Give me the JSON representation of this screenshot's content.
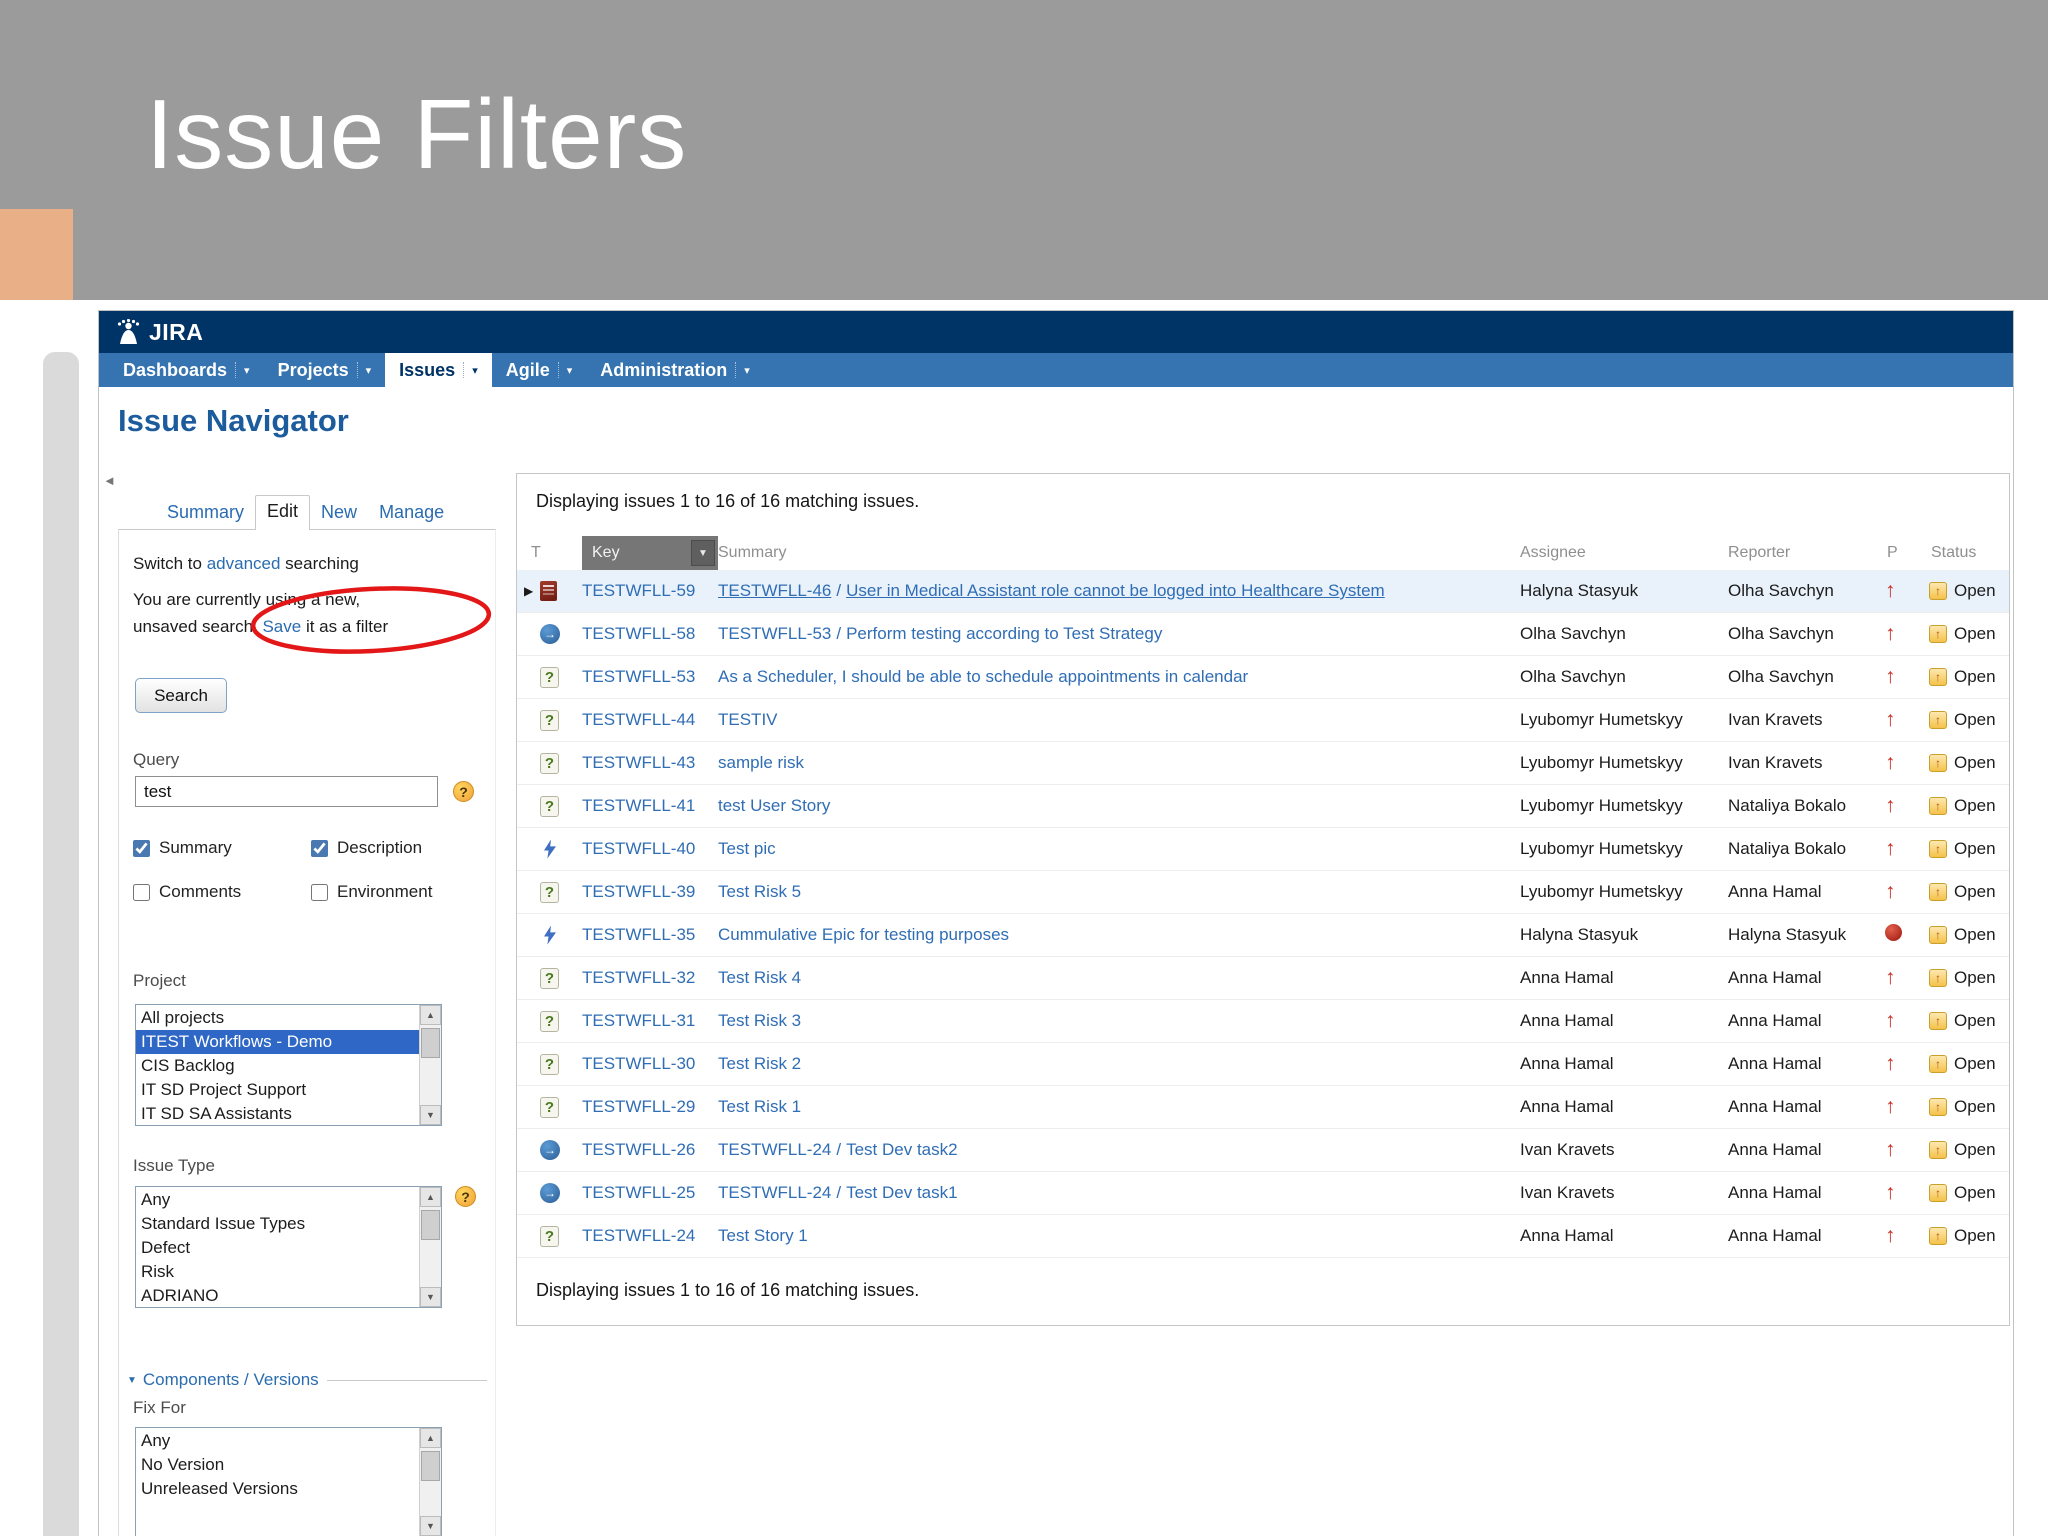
{
  "slide": {
    "title": "Issue Filters"
  },
  "colors": {
    "header_bg": "#003366",
    "nav_bg": "#3573b1",
    "link": "#2f6db5",
    "annotation": "#e31717",
    "highlight_row": "#e9f2fb",
    "selected_option_bg": "#2e67c6",
    "accent_square": "#e9b088",
    "band": "#9b9b9b"
  },
  "icons": {
    "current_marker": "▶",
    "type_question": "?",
    "subtask_arrow": "→",
    "priority_arrow": "↑",
    "status_arrow": "↑",
    "scroll_up": "▲",
    "scroll_down": "▼",
    "sort": "▼",
    "nav_caret": "▾",
    "collapse": "◄",
    "help": "?",
    "section_triangle": "▼"
  },
  "app": {
    "logo_text": "JIRA",
    "nav": [
      {
        "label": "Dashboards"
      },
      {
        "label": "Projects"
      },
      {
        "label": "Issues",
        "active": true
      },
      {
        "label": "Agile"
      },
      {
        "label": "Administration"
      }
    ],
    "page_title": "Issue Navigator"
  },
  "sidebar": {
    "tabs": [
      {
        "label": "Summary"
      },
      {
        "label": "Edit",
        "active": true
      },
      {
        "label": "New"
      },
      {
        "label": "Manage"
      }
    ],
    "switch_prefix": "Switch to ",
    "switch_link": "advanced",
    "switch_suffix": " searching",
    "unsaved_line1": "You are currently using a new,",
    "unsaved_line2_pre": "unsaved search. ",
    "unsaved_link": "Save",
    "unsaved_line2_post": " it as a filter",
    "search_button": "Search",
    "query": {
      "label": "Query",
      "value": "test"
    },
    "checkboxes": [
      {
        "label": "Summary",
        "checked": true
      },
      {
        "label": "Description",
        "checked": true
      },
      {
        "label": "Comments",
        "checked": false
      },
      {
        "label": "Environment",
        "checked": false
      }
    ],
    "project": {
      "label": "Project",
      "options": [
        "All projects",
        "ITEST Workflows - Demo",
        "CIS Backlog",
        "IT SD Project Support",
        "IT SD SA Assistants"
      ],
      "selected": "ITEST Workflows - Demo"
    },
    "issue_type": {
      "label": "Issue Type",
      "options": [
        "Any",
        "Standard Issue Types",
        "Defect",
        "Risk",
        "ADRIANO"
      ],
      "selected": ""
    },
    "components_versions": {
      "header": "Components / Versions"
    },
    "fix_for": {
      "label": "Fix For",
      "options": [
        "Any",
        "No Version",
        "Unreleased Versions"
      ],
      "selected": ""
    }
  },
  "results": {
    "count_top": "Displaying issues 1 to 16 of 16 matching issues.",
    "count_bottom": "Displaying issues 1 to 16 of 16 matching issues.",
    "columns": {
      "t": "T",
      "key": "Key",
      "summary": "Summary",
      "assignee": "Assignee",
      "reporter": "Reporter",
      "priority": "P",
      "status": "Status"
    },
    "rows": [
      {
        "key": "TESTWFLL-59",
        "parent": "TESTWFLL-46",
        "summary": "User in Medical Assistant role cannot be logged into Healthcare System",
        "assignee": "Halyna Stasyuk",
        "reporter": "Olha Savchyn",
        "type": "doc",
        "priority": "major",
        "status": "Open",
        "current": true
      },
      {
        "key": "TESTWFLL-58",
        "parent": "TESTWFLL-53",
        "summary": "Perform testing according to Test Strategy",
        "assignee": "Olha Savchyn",
        "reporter": "Olha Savchyn",
        "type": "subtask",
        "priority": "major",
        "status": "Open"
      },
      {
        "key": "TESTWFLL-53",
        "parent": "",
        "summary": "As a Scheduler, I should be able to schedule appointments in calendar",
        "assignee": "Olha Savchyn",
        "reporter": "Olha Savchyn",
        "type": "question",
        "priority": "major",
        "status": "Open"
      },
      {
        "key": "TESTWFLL-44",
        "parent": "",
        "summary": "TESTIV",
        "assignee": "Lyubomyr Humetskyy",
        "reporter": "Ivan Kravets",
        "type": "question",
        "priority": "major",
        "status": "Open"
      },
      {
        "key": "TESTWFLL-43",
        "parent": "",
        "summary": "sample risk",
        "assignee": "Lyubomyr Humetskyy",
        "reporter": "Ivan Kravets",
        "type": "question",
        "priority": "major",
        "status": "Open"
      },
      {
        "key": "TESTWFLL-41",
        "parent": "",
        "summary": "test User Story",
        "assignee": "Lyubomyr Humetskyy",
        "reporter": "Nataliya Bokalo",
        "type": "question",
        "priority": "major",
        "status": "Open"
      },
      {
        "key": "TESTWFLL-40",
        "parent": "",
        "summary": "Test pic",
        "assignee": "Lyubomyr Humetskyy",
        "reporter": "Nataliya Bokalo",
        "type": "epic",
        "priority": "major",
        "status": "Open"
      },
      {
        "key": "TESTWFLL-39",
        "parent": "",
        "summary": "Test Risk 5",
        "assignee": "Lyubomyr Humetskyy",
        "reporter": "Anna Hamal",
        "type": "question",
        "priority": "major",
        "status": "Open"
      },
      {
        "key": "TESTWFLL-35",
        "parent": "",
        "summary": "Cummulative Epic for testing purposes",
        "assignee": "Halyna Stasyuk",
        "reporter": "Halyna Stasyuk",
        "type": "epic",
        "priority": "blocker",
        "status": "Open"
      },
      {
        "key": "TESTWFLL-32",
        "parent": "",
        "summary": "Test Risk 4",
        "assignee": "Anna Hamal",
        "reporter": "Anna Hamal",
        "type": "question",
        "priority": "major",
        "status": "Open"
      },
      {
        "key": "TESTWFLL-31",
        "parent": "",
        "summary": "Test Risk 3",
        "assignee": "Anna Hamal",
        "reporter": "Anna Hamal",
        "type": "question",
        "priority": "major",
        "status": "Open"
      },
      {
        "key": "TESTWFLL-30",
        "parent": "",
        "summary": "Test Risk 2",
        "assignee": "Anna Hamal",
        "reporter": "Anna Hamal",
        "type": "question",
        "priority": "major",
        "status": "Open"
      },
      {
        "key": "TESTWFLL-29",
        "parent": "",
        "summary": "Test Risk 1",
        "assignee": "Anna Hamal",
        "reporter": "Anna Hamal",
        "type": "question",
        "priority": "major",
        "status": "Open"
      },
      {
        "key": "TESTWFLL-26",
        "parent": "TESTWFLL-24",
        "summary": "Test Dev task2",
        "assignee": "Ivan Kravets",
        "reporter": "Anna Hamal",
        "type": "subtask",
        "priority": "major",
        "status": "Open"
      },
      {
        "key": "TESTWFLL-25",
        "parent": "TESTWFLL-24",
        "summary": "Test Dev task1",
        "assignee": "Ivan Kravets",
        "reporter": "Anna Hamal",
        "type": "subtask",
        "priority": "major",
        "status": "Open"
      },
      {
        "key": "TESTWFLL-24",
        "parent": "",
        "summary": "Test Story 1",
        "assignee": "Anna Hamal",
        "reporter": "Anna Hamal",
        "type": "question",
        "priority": "major",
        "status": "Open"
      }
    ]
  }
}
